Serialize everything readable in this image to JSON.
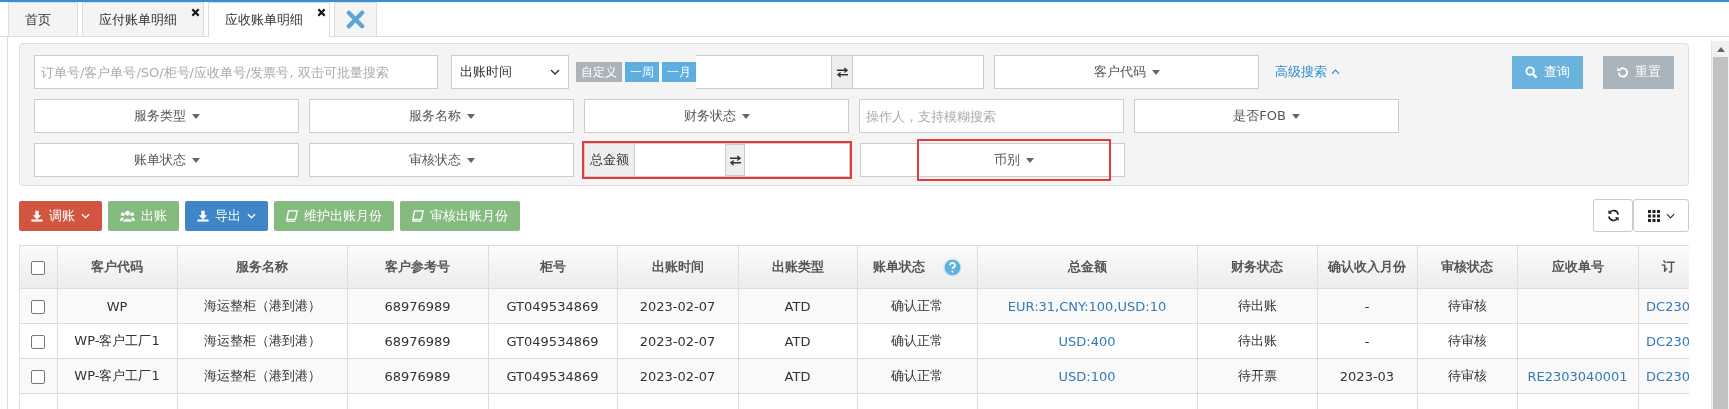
{
  "tabs": [
    {
      "label": "首页",
      "selected": false,
      "closable": false
    },
    {
      "label": "应付账单明细",
      "selected": false,
      "closable": true
    },
    {
      "label": "应收账单明细",
      "selected": true,
      "closable": true
    }
  ],
  "filters": {
    "rows": [
      [
        {
          "kind": "input",
          "placeholder": "订单号/客户单号/SO/柜号/应收单号/发票号, 双击可批量搜索"
        },
        {
          "kind": "daterange",
          "select": "出账时间",
          "presets": [
            {
              "label": "自定义",
              "color": "#a9b4bc"
            },
            {
              "label": "一周",
              "color": "#5eaee0"
            },
            {
              "label": "一月",
              "color": "#5eaee0"
            }
          ]
        },
        {
          "kind": "dropdown",
          "label": "客户代码",
          "highlighted": false
        },
        {
          "kind": "link",
          "label": "高级搜索"
        }
      ],
      [
        {
          "kind": "dropdown",
          "label": "服务类型",
          "highlighted": false
        },
        {
          "kind": "dropdown",
          "label": "服务名称",
          "highlighted": false
        },
        {
          "kind": "dropdown",
          "label": "财务状态",
          "highlighted": false
        },
        {
          "kind": "input",
          "placeholder": "操作人，支持模糊搜索"
        },
        {
          "kind": "dropdown",
          "label": "是否FOB",
          "highlighted": false
        }
      ],
      [
        {
          "kind": "dropdown",
          "label": "账单状态",
          "highlighted": false
        },
        {
          "kind": "dropdown",
          "label": "审核状态",
          "highlighted": false
        },
        {
          "kind": "range",
          "label": "总金额",
          "highlighted": true
        },
        {
          "kind": "dropdown",
          "label": "币别",
          "highlighted": true
        }
      ]
    ],
    "buttons": [
      {
        "label": "查询",
        "color": "#6cb2de"
      },
      {
        "label": "重置",
        "color": "#a9b4bc"
      }
    ]
  },
  "toolbar": [
    {
      "label": "调账",
      "color": "#d2553f",
      "caret": true
    },
    {
      "label": "出账",
      "color": "#86bb7f",
      "caret": false
    },
    {
      "label": "导出",
      "color": "#3e86c8",
      "caret": true
    },
    {
      "label": "维护出账月份",
      "color": "#86bb7f",
      "caret": false
    },
    {
      "label": "审核出账月份",
      "color": "#86bb7f",
      "caret": false
    }
  ],
  "table": {
    "select_all_checked": false,
    "columns": [
      {
        "label": "客户代码",
        "link": false,
        "help": false
      },
      {
        "label": "服务名称",
        "link": false,
        "help": false
      },
      {
        "label": "客户参考号",
        "link": false,
        "help": false
      },
      {
        "label": "柜号",
        "link": false,
        "help": false
      },
      {
        "label": "出账时间",
        "link": false,
        "help": false
      },
      {
        "label": "出账类型",
        "link": false,
        "help": false
      },
      {
        "label": "账单状态",
        "link": false,
        "help": true
      },
      {
        "label": "总金额",
        "link": true,
        "help": false
      },
      {
        "label": "财务状态",
        "link": false,
        "help": false
      },
      {
        "label": "确认收入月份",
        "link": false,
        "help": false
      },
      {
        "label": "审核状态",
        "link": false,
        "help": false
      },
      {
        "label": "应收单号",
        "link": true,
        "help": false
      },
      {
        "label": "订",
        "link": true,
        "help": false
      }
    ],
    "rows": [
      {
        "checked": false,
        "cells": [
          "WP",
          "海运整柜（港到港）",
          "68976989",
          "GT049534869",
          "2023-02-07",
          "ATD",
          "确认正常",
          "EUR:31,CNY:100,USD:10",
          "待出账",
          "-",
          "待审核",
          "",
          "DC230"
        ]
      },
      {
        "checked": false,
        "cells": [
          "WP-客户工厂1",
          "海运整柜（港到港）",
          "68976989",
          "GT049534869",
          "2023-02-07",
          "ATD",
          "确认正常",
          "USD:400",
          "待出账",
          "-",
          "待审核",
          "",
          "DC230"
        ]
      },
      {
        "checked": false,
        "cells": [
          "WP-客户工厂1",
          "海运整柜（港到港）",
          "68976989",
          "GT049534869",
          "2023-02-07",
          "ATD",
          "确认正常",
          "USD:100",
          "待开票",
          "2023-03",
          "待审核",
          "RE2303040001",
          "DC230"
        ]
      }
    ]
  }
}
